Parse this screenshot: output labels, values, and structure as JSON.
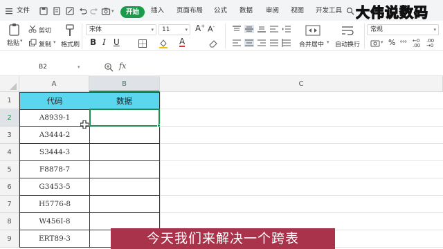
{
  "menu": {
    "file": "文件",
    "tabs": [
      "开始",
      "插入",
      "页面布局",
      "公式",
      "数据",
      "审阅",
      "视图",
      "开发工具"
    ]
  },
  "watermark": "大伟说数码",
  "ribbon": {
    "paste": "粘贴",
    "cut": "剪切",
    "copy": "复制",
    "format_painter": "格式刷",
    "font_name": "宋体",
    "font_size": "11",
    "merge_center": "合并居中",
    "wrap_text": "自动换行",
    "number_format": "常规",
    "percent": "%"
  },
  "formula_bar": {
    "name_box": "B2",
    "fx": "fx",
    "content": ""
  },
  "sheet": {
    "columns": [
      "A",
      "B",
      "C"
    ],
    "rows": [
      "1",
      "2",
      "3",
      "4",
      "5",
      "6",
      "7",
      "8",
      "9"
    ],
    "header_a": "代码",
    "header_b": "数据",
    "codes": [
      "A8939-1",
      "A3444-2",
      "S3444-3",
      "F8878-7",
      "G3453-5",
      "H5776-8",
      "W456I-8",
      "ERT89-3"
    ]
  },
  "subtitle": "今天我们来解决一个跨表",
  "colors": {
    "accent_green": "#1a9c4b",
    "header_fill": "#5ad6ee",
    "subtitle_bg": "#a8334a"
  }
}
